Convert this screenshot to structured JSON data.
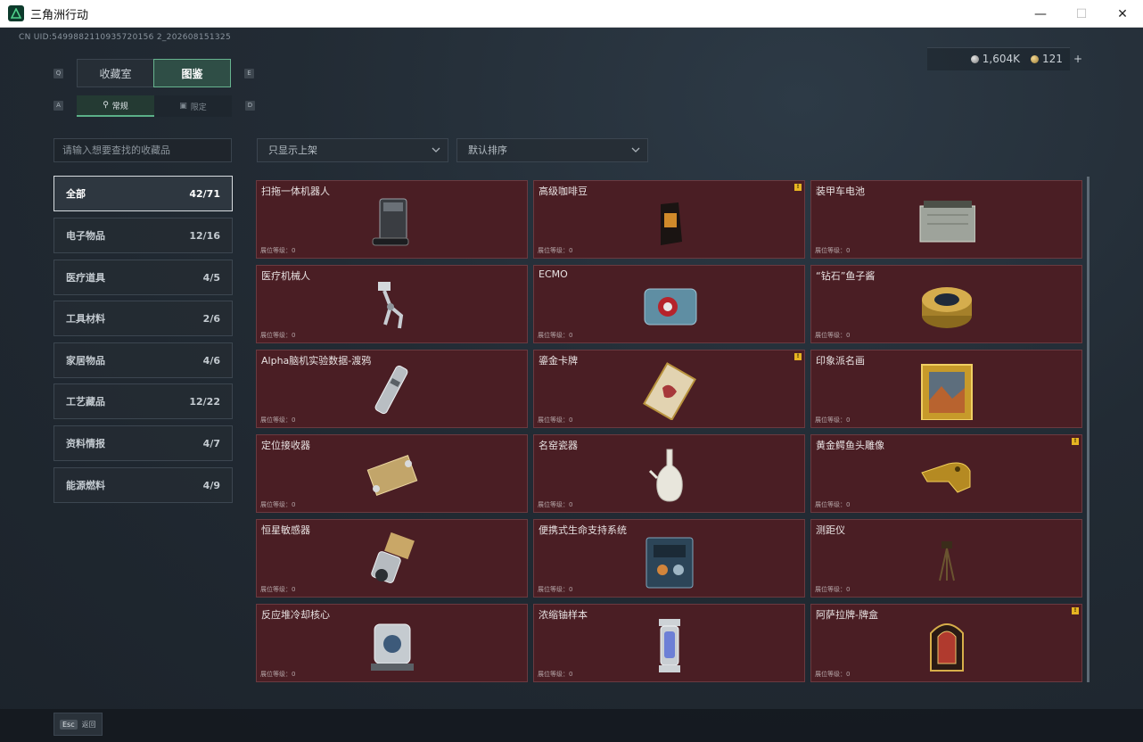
{
  "window": {
    "title": "三角洲行动",
    "controls": [
      "—",
      "☐",
      "✕"
    ]
  },
  "header": {
    "uid": "CN UID:5499882110935720156 2_202608151325",
    "currency": [
      {
        "icon": "silver-coin-icon",
        "value": "1,604K"
      },
      {
        "icon": "gold-coin-icon",
        "value": "121"
      }
    ],
    "add_label": "+"
  },
  "tabs": {
    "main": [
      {
        "label": "收藏室",
        "key": "Q",
        "active": false
      },
      {
        "label": "图鉴",
        "key": "E",
        "active": true
      }
    ],
    "sub": [
      {
        "label": "常规",
        "key": "A",
        "active": true
      },
      {
        "label": "限定",
        "key": "D",
        "active": false
      }
    ]
  },
  "search": {
    "placeholder": "请输入想要查找的收藏品"
  },
  "filters": {
    "shelf": "只显示上架",
    "sort": "默认排序"
  },
  "categories": [
    {
      "label": "全部",
      "count": "42/71",
      "active": true
    },
    {
      "label": "电子物品",
      "count": "12/16"
    },
    {
      "label": "医疗道具",
      "count": "4/5"
    },
    {
      "label": "工具材料",
      "count": "2/6"
    },
    {
      "label": "家居物品",
      "count": "4/6"
    },
    {
      "label": "工艺藏品",
      "count": "12/22"
    },
    {
      "label": "资料情报",
      "count": "4/7"
    },
    {
      "label": "能源燃料",
      "count": "4/9"
    }
  ],
  "items": [
    {
      "name": "扫拖一体机器人",
      "level": "展位等级：0",
      "badge": false
    },
    {
      "name": "高级咖啡豆",
      "level": "展位等级：0",
      "badge": true
    },
    {
      "name": "装甲车电池",
      "level": "展位等级：0",
      "badge": false
    },
    {
      "name": "医疗机械人",
      "level": "展位等级：0",
      "badge": false
    },
    {
      "name": "ECMO",
      "level": "展位等级：0",
      "badge": false
    },
    {
      "name": "“钻石”鱼子酱",
      "level": "展位等级：0",
      "badge": false
    },
    {
      "name": "Alpha脑机实验数据-渡鸦",
      "level": "展位等级：0",
      "badge": false
    },
    {
      "name": "鎏金卡牌",
      "level": "展位等级：0",
      "badge": true
    },
    {
      "name": "印象派名画",
      "level": "展位等级：0",
      "badge": false
    },
    {
      "name": "定位接收器",
      "level": "展位等级：0",
      "badge": false
    },
    {
      "name": "名窑瓷器",
      "level": "展位等级：0",
      "badge": false
    },
    {
      "name": "黄金鳄鱼头雕像",
      "level": "展位等级：0",
      "badge": true
    },
    {
      "name": "恒星敏感器",
      "level": "展位等级：0",
      "badge": false
    },
    {
      "name": "便携式生命支持系统",
      "level": "展位等级：0",
      "badge": false
    },
    {
      "name": "测距仪",
      "level": "展位等级：0",
      "badge": false
    },
    {
      "name": "反应堆冷却核心",
      "level": "展位等级：0",
      "badge": false
    },
    {
      "name": "浓缩铀样本",
      "level": "展位等级：0",
      "badge": false
    },
    {
      "name": "阿萨拉牌-牌盒",
      "level": "展位等级：0",
      "badge": true
    }
  ],
  "footer": {
    "esc_key": "Esc",
    "back_label": "返回"
  },
  "colors": {
    "card_bg": "#4a1e24",
    "accent": "#5bb088",
    "badge": "#e6b422"
  }
}
